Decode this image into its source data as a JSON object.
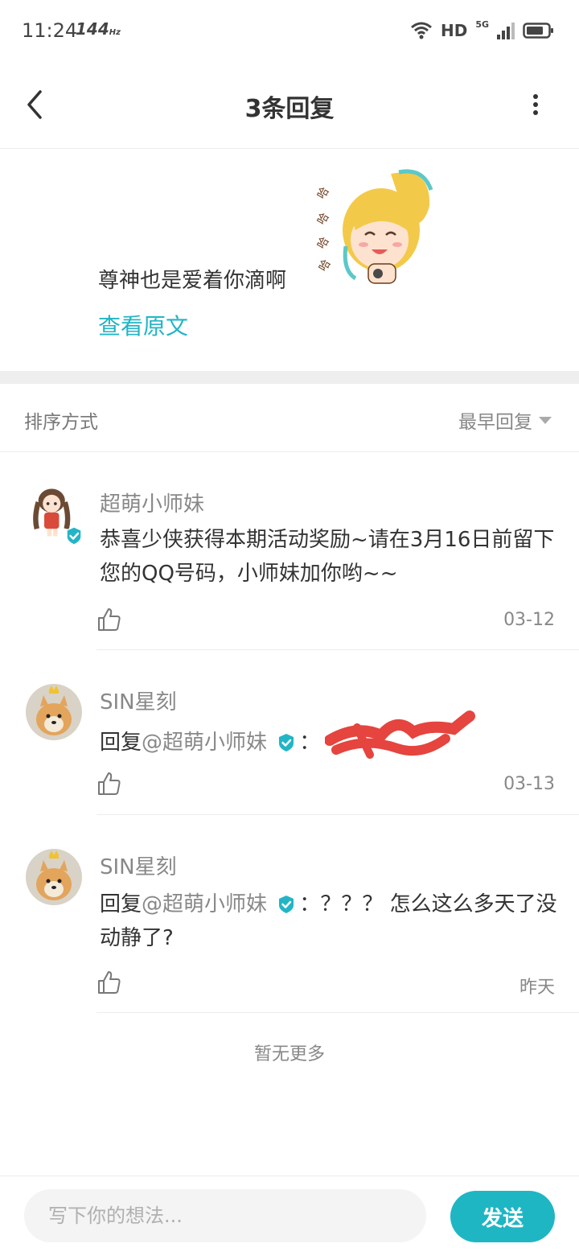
{
  "status_bar": {
    "time": "11:24",
    "refresh_rate": "144",
    "refresh_unit": "Hz",
    "hd": "HD",
    "network": "5G"
  },
  "header": {
    "title": "3条回复"
  },
  "original": {
    "text": "尊神也是爱着你滴啊",
    "view_original": "查看原文"
  },
  "sort": {
    "label": "排序方式",
    "value": "最早回复"
  },
  "replies": [
    {
      "name": "超萌小师妹",
      "content": "恭喜少侠获得本期活动奖励~请在3月16日前留下您的QQ号码，小师妹加你哟~~",
      "date": "03-12"
    },
    {
      "name": "SIN星刻",
      "reply_prefix": "回复",
      "mention": "@超萌小师妹",
      "colon": "：",
      "content": "",
      "date": "03-13"
    },
    {
      "name": "SIN星刻",
      "reply_prefix": "回复",
      "mention": "@超萌小师妹",
      "colon": "：",
      "content": "？？？ 怎么这么多天了没动静了?",
      "date": "昨天"
    }
  ],
  "footer": {
    "no_more": "暂无更多"
  },
  "compose": {
    "placeholder": "写下你的想法...",
    "send_label": "发送"
  },
  "colors": {
    "accent": "#1fb6c4",
    "verified": "#22b5c6"
  }
}
